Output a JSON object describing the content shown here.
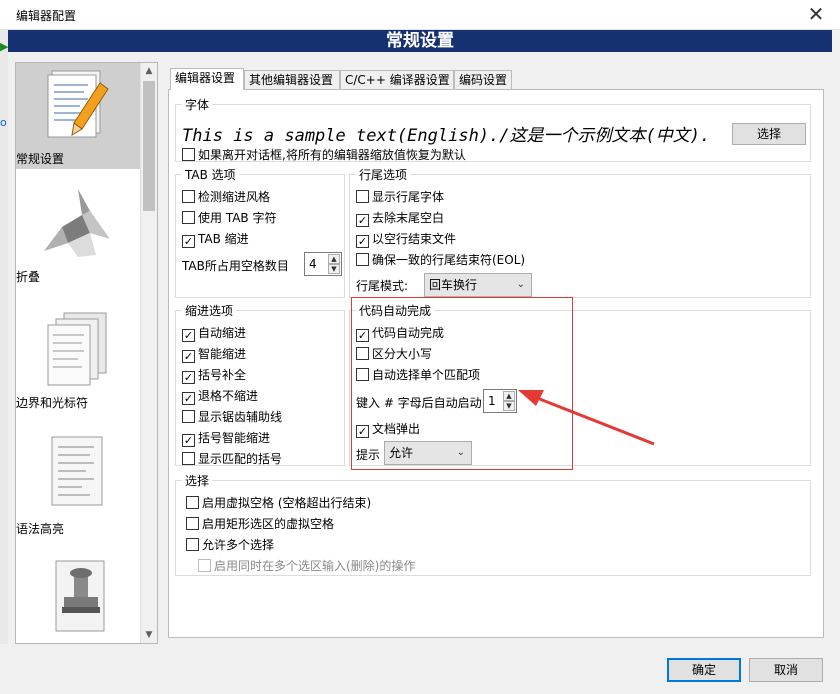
{
  "window": {
    "title": "编辑器配置",
    "close_glyph": "✕"
  },
  "banner": {
    "title": "常规设置"
  },
  "categories": [
    {
      "label": "常规设置",
      "icon": "document-pencil-icon"
    },
    {
      "label": "折叠",
      "icon": "origami-bird-icon"
    },
    {
      "label": "边界和光标符",
      "icon": "document-stack-icon"
    },
    {
      "label": "语法高亮",
      "icon": "highlighted-document-icon"
    },
    {
      "label": "",
      "icon": "stamp-icon"
    }
  ],
  "tabs": [
    {
      "label": "编辑器设置",
      "active": true
    },
    {
      "label": "其他编辑器设置",
      "active": false
    },
    {
      "label": "C/C++ 编译器设置",
      "active": false
    },
    {
      "label": "编码设置",
      "active": false
    }
  ],
  "font_group": {
    "legend": "字体",
    "sample": "This is a sample text(English)./这是一个示例文本(中文).",
    "choose_button": "选择",
    "reset_checkbox": {
      "label": "如果离开对话框,将所有的编辑器缩放值恢复为默认",
      "checked": false
    }
  },
  "tab_group": {
    "legend": "TAB 选项",
    "items": [
      {
        "label": "检测缩进风格",
        "checked": false
      },
      {
        "label": "使用 TAB 字符",
        "checked": false
      },
      {
        "label": "TAB 缩进",
        "checked": true
      }
    ],
    "spaces_label": "TAB所占用空格数目",
    "spaces_value": "4"
  },
  "eol_group": {
    "legend": "行尾选项",
    "items": [
      {
        "label": "显示行尾字体",
        "checked": false
      },
      {
        "label": "去除末尾空白",
        "checked": true
      },
      {
        "label": "以空行结束文件",
        "checked": true
      },
      {
        "label": "确保一致的行尾结束符(EOL)",
        "checked": false
      }
    ],
    "mode_label": "行尾模式:",
    "mode_value": "回车换行"
  },
  "indent_group": {
    "legend": "缩进选项",
    "items": [
      {
        "label": "自动缩进",
        "checked": true
      },
      {
        "label": "智能缩进",
        "checked": true
      },
      {
        "label": "括号补全",
        "checked": true
      },
      {
        "label": "退格不缩进",
        "checked": true
      },
      {
        "label": "显示锯齿辅助线",
        "checked": false
      },
      {
        "label": "括号智能缩进",
        "checked": true
      },
      {
        "label": "显示匹配的括号",
        "checked": false
      }
    ]
  },
  "autocomplete_group": {
    "legend": "代码自动完成",
    "items": [
      {
        "label": "代码自动完成",
        "checked": true
      },
      {
        "label": "区分大小写",
        "checked": false
      },
      {
        "label": "自动选择单个匹配项",
        "checked": false
      }
    ],
    "trigger_label": "键入 # 字母后自动启动:",
    "trigger_value": "1",
    "doc_popup": {
      "label": "文档弹出",
      "checked": true
    },
    "hint_label": "提示",
    "hint_value": "允许"
  },
  "selection_group": {
    "legend": "选择",
    "items": [
      {
        "label": "启用虚拟空格 (空格超出行结束)",
        "checked": false,
        "disabled": false
      },
      {
        "label": "启用矩形选区的虚拟空格",
        "checked": false,
        "disabled": false
      },
      {
        "label": "允许多个选择",
        "checked": false,
        "disabled": false
      },
      {
        "label": "启用同时在多个选区输入(删除)的操作",
        "checked": false,
        "disabled": true
      }
    ]
  },
  "buttons": {
    "ok": "确定",
    "cancel": "取消"
  },
  "colors": {
    "banner": "#16316f",
    "annotation": "#e53935",
    "accent": "#0078d7"
  }
}
